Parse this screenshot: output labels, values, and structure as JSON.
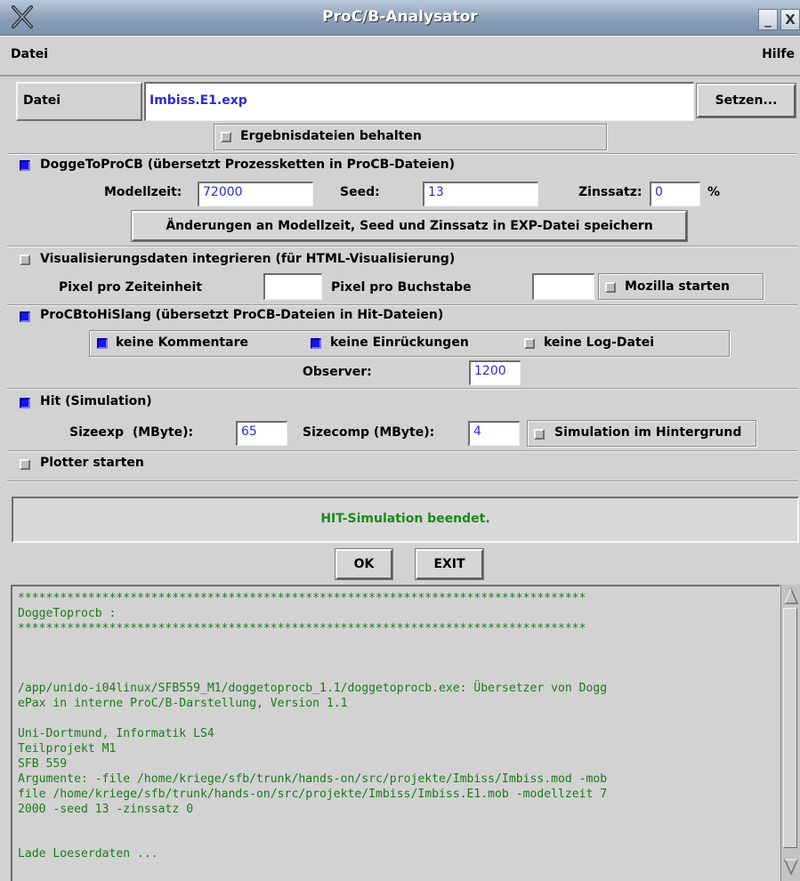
{
  "window": {
    "title": "ProC/B-Analysator",
    "minimize_label": "_",
    "close_label": "X"
  },
  "menubar": {
    "datei": "Datei",
    "hilfe": "Hilfe"
  },
  "file": {
    "label": "Datei",
    "value": "Imbiss.E1.exp",
    "set_button": "Setzen..."
  },
  "keep_results": {
    "label": "Ergebnisdateien behalten",
    "checked": false
  },
  "doggetoprocb": {
    "label": "DoggeToProCB (übersetzt Prozessketten in ProCB-Dateien)",
    "checked": true,
    "modellzeit_label": "Modellzeit:",
    "modellzeit": "72000",
    "seed_label": "Seed:",
    "seed": "13",
    "zinssatz_label": "Zinssatz:",
    "zinssatz": "0",
    "percent": "%",
    "save_button": "Änderungen an Modellzeit, Seed und Zinssatz in EXP-Datei speichern"
  },
  "visualization": {
    "label": "Visualisierungsdaten integrieren (für HTML-Visualisierung)",
    "checked": false,
    "pixel_time_label": "Pixel pro Zeiteinheit",
    "pixel_time": "",
    "pixel_char_label": "Pixel pro Buchstabe",
    "pixel_char": "",
    "mozilla_label": "Mozilla starten",
    "mozilla_checked": false
  },
  "procbtohislang": {
    "label": "ProCBtoHiSlang (übersetzt ProCB-Dateien in Hit-Dateien)",
    "checked": true,
    "no_comments": "keine Kommentare",
    "no_comments_checked": true,
    "no_indent": "keine Einrückungen",
    "no_indent_checked": true,
    "no_log": "keine Log-Datei",
    "no_log_checked": false,
    "observer_label": "Observer:",
    "observer": "1200"
  },
  "hit": {
    "label": "Hit (Simulation)",
    "checked": true,
    "sizeexp_label": "Sizeexp  (MByte):",
    "sizeexp": "65",
    "sizecomp_label": "Sizecomp (MByte):",
    "sizecomp": "4",
    "background_label": "Simulation im Hintergrund",
    "background_checked": false
  },
  "plotter": {
    "label": "Plotter starten",
    "checked": false
  },
  "status": {
    "text": "HIT-Simulation beendet.",
    "color": "#1a8a1a"
  },
  "buttons": {
    "ok": "OK",
    "exit": "EXIT"
  },
  "log": {
    "color": "#1c7a1c",
    "text": "*********************************************************************************\nDoggeToprocb :\n*********************************************************************************\n\n\n\n/app/unido-i04linux/SFB559_M1/doggetoprocb_1.1/doggetoprocb.exe: Übersetzer von Dogg\nePax in interne ProC/B-Darstellung, Version 1.1\n\nUni-Dortmund, Informatik LS4\nTeilprojekt M1\nSFB 559\nArgumente: -file /home/kriege/sfb/trunk/hands-on/src/projekte/Imbiss/Imbiss.mod -mob\nfile /home/kriege/sfb/trunk/hands-on/src/projekte/Imbiss/Imbiss.E1.mob -modellzeit 7\n2000 -seed 13 -zinssatz 0\n\n\nLade Loeserdaten ..."
  }
}
